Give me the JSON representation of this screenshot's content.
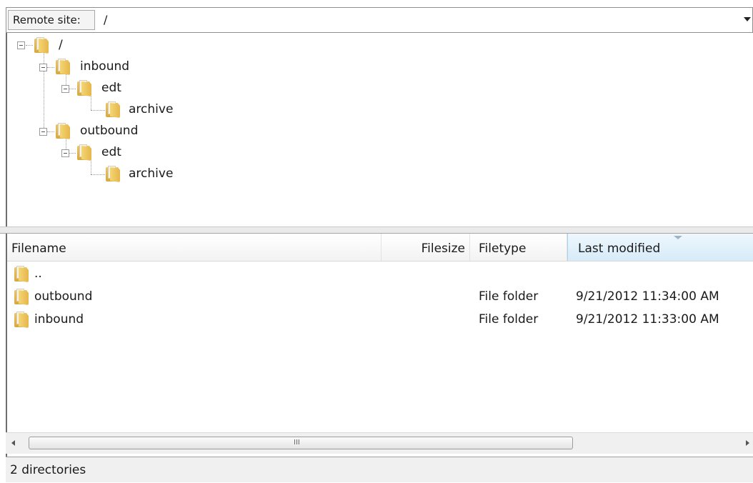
{
  "remote_site": {
    "label": "Remote site:",
    "path": "/"
  },
  "tree": [
    {
      "label": "/"
    },
    {
      "label": "inbound"
    },
    {
      "label": "edt"
    },
    {
      "label": "archive"
    },
    {
      "label": "outbound"
    },
    {
      "label": "edt"
    },
    {
      "label": "archive"
    }
  ],
  "file_list": {
    "columns": {
      "filename": "Filename",
      "filesize": "Filesize",
      "filetype": "Filetype",
      "last_modified": "Last modified"
    },
    "sorted_column": "Last modified",
    "rows": [
      {
        "name": "..",
        "size": "",
        "type": "",
        "modified": ""
      },
      {
        "name": "outbound",
        "size": "",
        "type": "File folder",
        "modified": "9/21/2012 11:34:00 AM"
      },
      {
        "name": "inbound",
        "size": "",
        "type": "File folder",
        "modified": "9/21/2012 11:33:00 AM"
      }
    ]
  },
  "scrollbar": {
    "grip": "III"
  },
  "status": {
    "text": "2 directories"
  },
  "icons": {
    "folder": "folder-icon",
    "expander": "tree-collapse-icon"
  },
  "colors": {
    "folder": "#e6b64a",
    "sorted_header": "#d6ebf8"
  }
}
